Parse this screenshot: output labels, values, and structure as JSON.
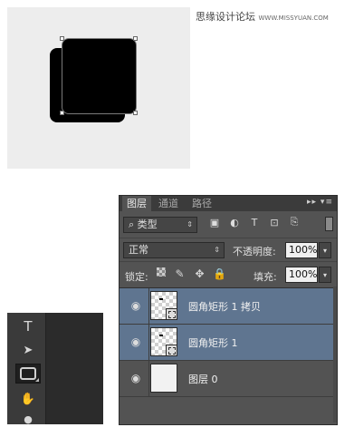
{
  "watermark": {
    "text": "思缘设计论坛",
    "site": "WWW.MISSYUAN.COM"
  },
  "canvas": {
    "shape_color": "#000000",
    "background": "#ededed"
  },
  "toolbox": {
    "tools": [
      {
        "name": "type-tool",
        "glyph": "T"
      },
      {
        "name": "path-selection-tool",
        "glyph": "➤"
      },
      {
        "name": "rounded-rectangle-tool",
        "glyph": ""
      },
      {
        "name": "hand-tool",
        "glyph": "✋"
      },
      {
        "name": "zoom-tool",
        "glyph": "●"
      }
    ],
    "active_tool": "rounded-rectangle-tool"
  },
  "layers_panel": {
    "tabs": [
      "图层",
      "通道",
      "路径"
    ],
    "active_tab": "图层",
    "menu_controls": "▸▸ ▾≡",
    "filter": {
      "search_glyph": "⌕",
      "label": "类型",
      "arrow": "⇕"
    },
    "filter_icons": [
      {
        "name": "image-filter-icon",
        "glyph": "▣"
      },
      {
        "name": "adjustment-filter-icon",
        "glyph": "◐"
      },
      {
        "name": "type-filter-icon",
        "glyph": "T"
      },
      {
        "name": "shape-filter-icon",
        "glyph": "⊡"
      },
      {
        "name": "smart-object-filter-icon",
        "glyph": "⎘"
      }
    ],
    "blend_mode": {
      "value": "正常",
      "arrow": "⇕"
    },
    "opacity": {
      "label": "不透明度:",
      "value": "100%"
    },
    "lock": {
      "label": "锁定:",
      "icons": [
        "pixels",
        "✎",
        "✥",
        "🔒"
      ]
    },
    "fill": {
      "label": "填充:",
      "value": "100%"
    },
    "dropdown_arrow": "▾",
    "eye_glyph": "◉",
    "layers": [
      {
        "name": "圆角矩形 1 拷贝",
        "selected": true,
        "type": "shape"
      },
      {
        "name": "圆角矩形 1",
        "selected": true,
        "type": "shape"
      },
      {
        "name": "图层 0",
        "selected": false,
        "type": "pixel"
      }
    ]
  }
}
